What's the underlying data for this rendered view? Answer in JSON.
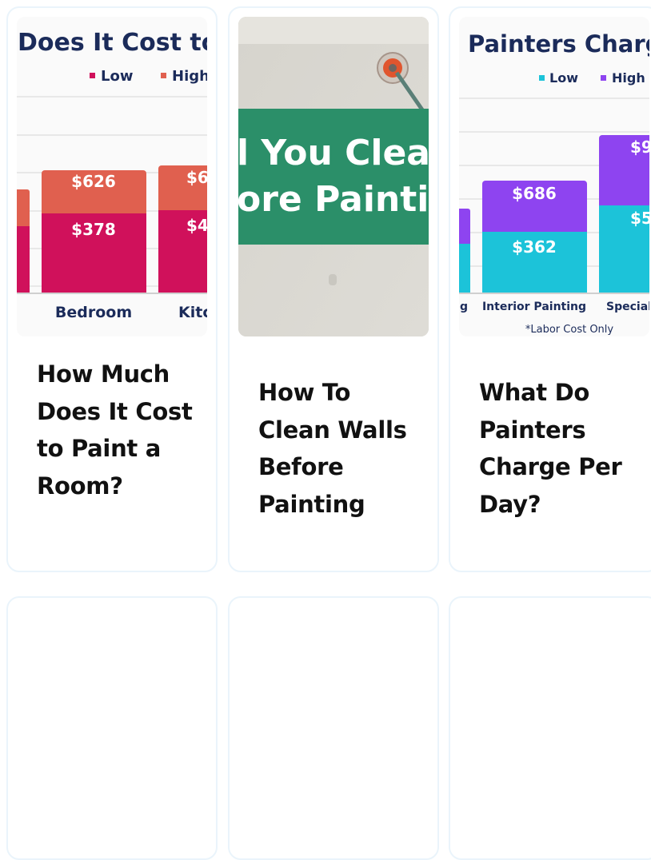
{
  "cards": [
    {
      "title": "How Much Does It Cost to Paint a Room?",
      "image": {
        "heading": "Does It Cost to P",
        "legend": [
          "Low",
          "High"
        ],
        "colors": {
          "low": "#d0115b",
          "high": "#e0604f"
        },
        "categories": [
          "Bedroom",
          "Kitc"
        ],
        "bar_labels": [
          {
            "low": "$378",
            "high": "$626"
          },
          {
            "low": "$4",
            "high": "$6"
          }
        ]
      }
    },
    {
      "title": "How To Clean Walls Before Painting",
      "image": {
        "banner_lines": [
          "l You Clean",
          "ore Painti"
        ],
        "banner_color": "#2b8f69"
      }
    },
    {
      "title": "What Do Painters Charge Per Day?",
      "image": {
        "heading": "Painters Charg",
        "legend": [
          "Low",
          "High"
        ],
        "colors": {
          "low": "#1cc3d9",
          "high": "#8e44f0"
        },
        "categories": [
          "g",
          "Interior Painting",
          "Special"
        ],
        "bar_labels": [
          {
            "low": "$362",
            "high": "$686"
          },
          {
            "low": "$5",
            "high": "$9"
          }
        ],
        "footnote": "*Labor Cost Only"
      }
    }
  ]
}
